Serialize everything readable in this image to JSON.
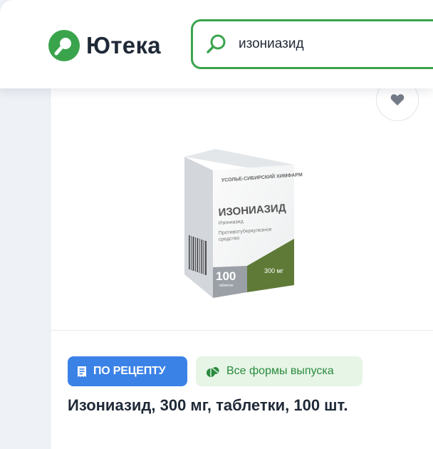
{
  "header": {
    "logo_text": "Ютека",
    "search": {
      "value": "изониазид",
      "placeholder": ""
    }
  },
  "product": {
    "image": {
      "brand": "УСОЛЬЕ-СИБИРСКИЙ ХИМФАРМЗАВОД",
      "name": "ИЗОНИАЗИД",
      "subtitle": "Изониазид",
      "description_line1": "Противотуберкулезное",
      "description_line2": "средство",
      "count": "100",
      "count_label": "таблеток",
      "dose": "300 мг"
    },
    "prescription_badge": "ПО РЕЦЕПТУ",
    "forms_badge": "Все формы выпуска",
    "title": "Изониазид, 300 мг, таблетки, 100 шт."
  },
  "colors": {
    "accent_green": "#3aa44c",
    "prescription_blue": "#3b82e6",
    "forms_bg": "#e6f5e6",
    "text_dark": "#1f2937"
  }
}
